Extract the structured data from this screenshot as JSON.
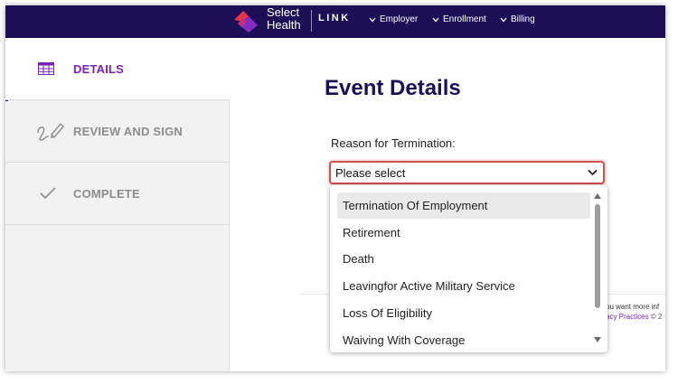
{
  "colors": {
    "nav_bg": "#1d0f57",
    "accent_purple": "#7a21b5",
    "title_navy": "#1d0f57",
    "error_red": "#d24d4d",
    "logo_red": "#e8334a",
    "logo_purple": "#8b2fc9"
  },
  "header": {
    "brand_line1": "Select",
    "brand_line2": "Health",
    "product": "LINK",
    "nav": [
      {
        "label": "Employer",
        "icon": "chevron-down-icon"
      },
      {
        "label": "Enrollment",
        "icon": "chevron-down-icon"
      },
      {
        "label": "Billing",
        "icon": "chevron-down-icon"
      }
    ]
  },
  "sidebar": {
    "steps": [
      {
        "label": "DETAILS",
        "icon": "table-icon",
        "state": "active"
      },
      {
        "label": "REVIEW AND SIGN",
        "icon": "signature-pen-icon",
        "state": "pending"
      },
      {
        "label": "COMPLETE",
        "icon": "checkmark-icon",
        "state": "pending"
      }
    ]
  },
  "main": {
    "title": "Event Details",
    "field_label": "Reason for Termination:",
    "select": {
      "value": "Please select",
      "options": [
        "Termination Of Employment",
        "Retirement",
        "Death",
        "Leavingfor Active Military Service",
        "Loss Of Eligibility",
        "Waiving With Coverage"
      ],
      "highlighted_index": 0
    }
  },
  "footer": {
    "text1": "ou want more inf",
    "link": "acy Practices",
    "text2": " © 2"
  }
}
